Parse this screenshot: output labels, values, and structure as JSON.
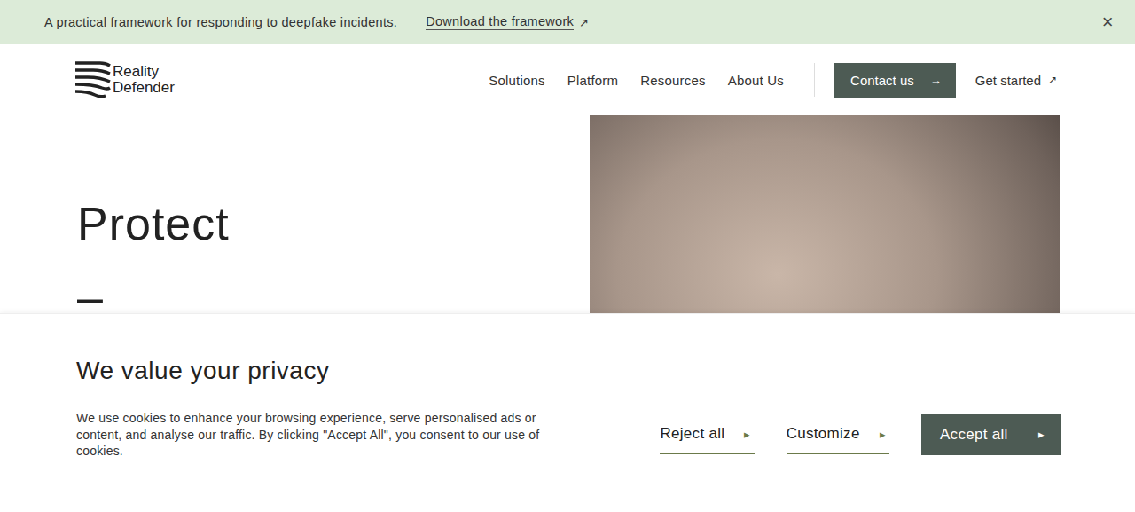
{
  "announcement": {
    "text": "A practical framework for responding to deepfake incidents.",
    "link": "Download the framework",
    "link_icon": "↗",
    "close": "×"
  },
  "logo": {
    "lines": [
      "Reality",
      "Defender"
    ]
  },
  "nav": {
    "items": [
      "Solutions",
      "Platform",
      "Resources",
      "About Us"
    ],
    "contact": {
      "label": "Contact us",
      "icon": "→"
    },
    "get_started": {
      "label": "Get started",
      "icon": "↗"
    }
  },
  "hero": {
    "headline": "Protect",
    "dash": "–"
  },
  "cookie": {
    "title": "We value your privacy",
    "text": "We use cookies to enhance your browsing experience, serve personalised ads or content, and analyse our traffic. By clicking \"Accept All\", you consent to our use of cookies.",
    "buttons": [
      {
        "label": "Reject all",
        "icon": "▸",
        "kind": "link"
      },
      {
        "label": "Customize",
        "icon": "▸",
        "kind": "link"
      },
      {
        "label": "Accept all",
        "icon": "▸",
        "kind": "primary"
      }
    ]
  }
}
